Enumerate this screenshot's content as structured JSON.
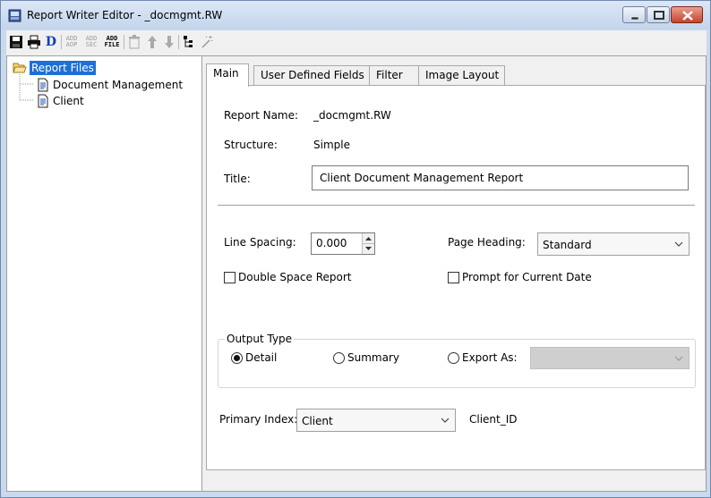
{
  "window": {
    "title": "Report Writer Editor - _docmgmt.RW"
  },
  "toolbar": {
    "items": [
      {
        "icon": "save-icon"
      },
      {
        "icon": "print-icon"
      },
      {
        "icon": "d-icon",
        "label": "D"
      },
      {
        "icon": "add-aop-icon",
        "label_top": "ADD",
        "label_bottom": "AOP"
      },
      {
        "icon": "add-sec-icon",
        "label_top": "ADD",
        "label_bottom": "SEC"
      },
      {
        "icon": "add-file-icon",
        "label_top": "ADD",
        "label_bottom": "FILE"
      },
      {
        "icon": "delete-icon"
      },
      {
        "icon": "arrow-up-icon"
      },
      {
        "icon": "arrow-down-icon"
      },
      {
        "icon": "tree-view-icon"
      },
      {
        "icon": "magic-wand-icon"
      }
    ]
  },
  "tree": {
    "root": "Report Files",
    "children": [
      "Document Management",
      "Client"
    ]
  },
  "tabs": [
    {
      "label": "Main",
      "active": true
    },
    {
      "label": "User Defined Fields"
    },
    {
      "label": "Filter"
    },
    {
      "label": "Image Layout"
    }
  ],
  "main": {
    "report_name_label": "Report Name:",
    "report_name_value": "_docmgmt.RW",
    "structure_label": "Structure:",
    "structure_value": "Simple",
    "title_label": "Title:",
    "title_value": "Client Document Management Report",
    "line_spacing_label": "Line Spacing:",
    "line_spacing_value": "0.000",
    "page_heading_label": "Page Heading:",
    "page_heading_value": "Standard",
    "double_space_label": "Double Space Report",
    "double_space_checked": false,
    "prompt_date_label": "Prompt for Current Date",
    "prompt_date_checked": false,
    "output_type": {
      "title": "Output Type",
      "options": [
        "Detail",
        "Summary",
        "Export As:"
      ],
      "selected": "Detail",
      "export_value": ""
    },
    "primary_index_label": "Primary Index:",
    "primary_index_value": "Client",
    "primary_index_field": "Client_ID"
  },
  "colors": {
    "selection": "#1e6fd8",
    "titlebar": "#c9d9ee"
  }
}
